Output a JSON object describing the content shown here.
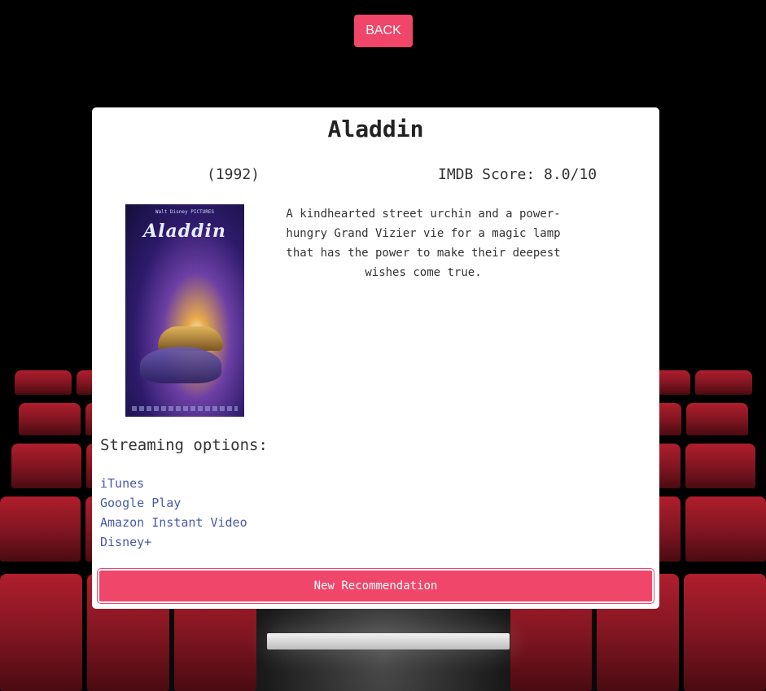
{
  "header": {
    "back_label": "BACK"
  },
  "movie": {
    "title": "Aladdin",
    "year": "(1992)",
    "imdb_score": "IMDB Score: 8.0/10",
    "description": "A kindhearted street urchin and a power-hungry Grand Vizier vie for a magic lamp that has the power to make their deepest wishes come true.",
    "poster_title": "Aladdin"
  },
  "streaming": {
    "heading": "Streaming options:",
    "options": [
      "iTunes",
      "Google Play",
      "Amazon Instant Video",
      "Disney+"
    ]
  },
  "actions": {
    "new_recommendation_label": "New Recommendation"
  },
  "colors": {
    "accent": "#f0466a",
    "link": "#4a5aa8",
    "card_bg": "#ffffff",
    "page_bg": "#000000"
  }
}
